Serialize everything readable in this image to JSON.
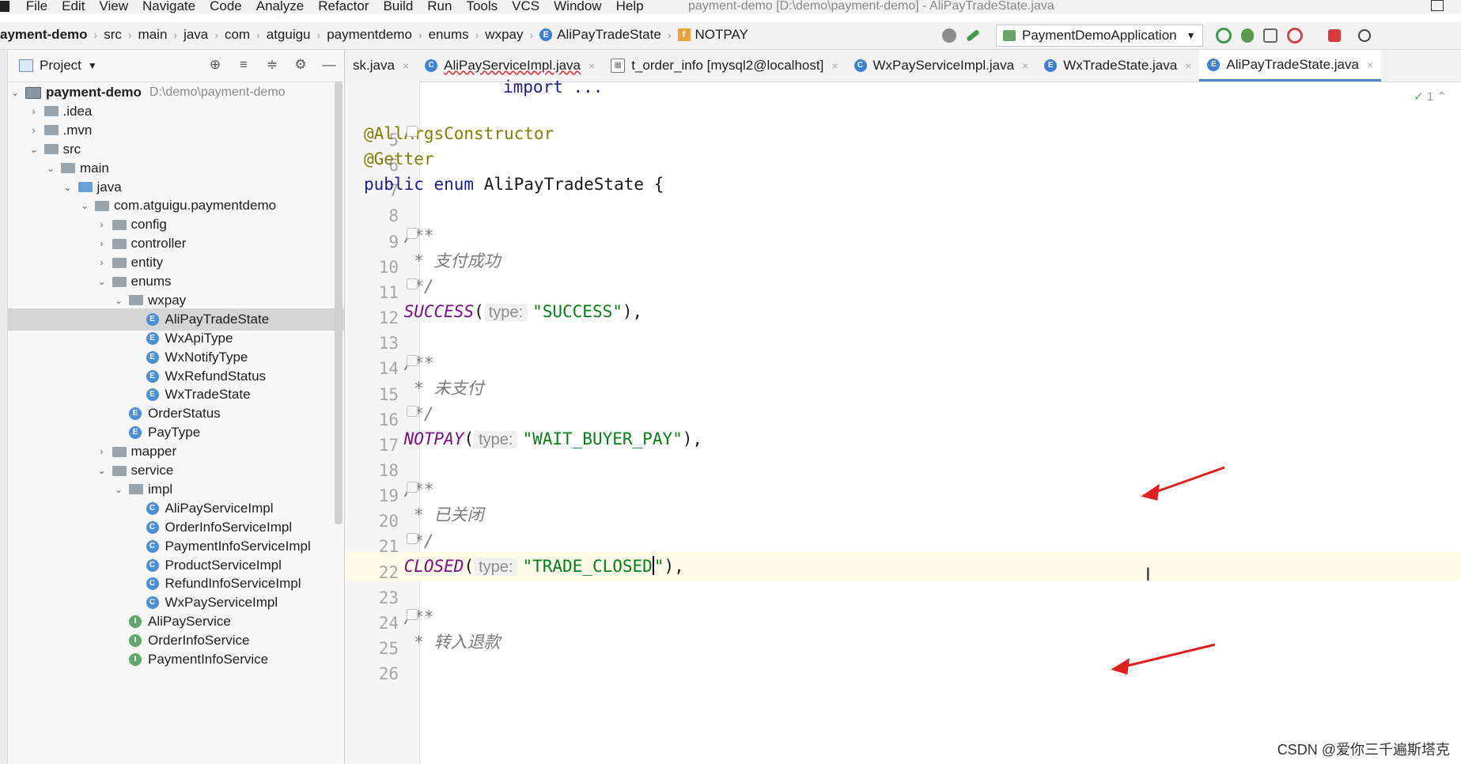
{
  "menu": {
    "items": [
      "File",
      "Edit",
      "View",
      "Navigate",
      "Code",
      "Analyze",
      "Refactor",
      "Build",
      "Run",
      "Tools",
      "VCS",
      "Window",
      "Help"
    ],
    "window_title": "payment-demo [D:\\demo\\payment-demo] - AliPayTradeState.java"
  },
  "breadcrumbs": [
    "ayment-demo",
    "src",
    "main",
    "java",
    "com",
    "atguigu",
    "paymentdemo",
    "enums",
    "wxpay",
    "AliPayTradeState",
    "NOTPAY"
  ],
  "toolbar": {
    "run_config": "PaymentDemoApplication"
  },
  "project_panel": {
    "title": "Project",
    "root": {
      "name": "payment-demo",
      "path": "D:\\demo\\payment-demo"
    },
    "rows": [
      {
        "label": ".idea",
        "indent": 1,
        "arrow": "›",
        "icon": "folder"
      },
      {
        "label": ".mvn",
        "indent": 1,
        "arrow": "›",
        "icon": "folder"
      },
      {
        "label": "src",
        "indent": 1,
        "arrow": "⌄",
        "icon": "folder"
      },
      {
        "label": "main",
        "indent": 2,
        "arrow": "⌄",
        "icon": "folder"
      },
      {
        "label": "java",
        "indent": 3,
        "arrow": "⌄",
        "icon": "folder-blue"
      },
      {
        "label": "com.atguigu.paymentdemo",
        "indent": 4,
        "arrow": "⌄",
        "icon": "folder"
      },
      {
        "label": "config",
        "indent": 5,
        "arrow": "›",
        "icon": "folder"
      },
      {
        "label": "controller",
        "indent": 5,
        "arrow": "›",
        "icon": "folder"
      },
      {
        "label": "entity",
        "indent": 5,
        "arrow": "›",
        "icon": "folder"
      },
      {
        "label": "enums",
        "indent": 5,
        "arrow": "⌄",
        "icon": "folder"
      },
      {
        "label": "wxpay",
        "indent": 6,
        "arrow": "⌄",
        "icon": "folder"
      },
      {
        "label": "AliPayTradeState",
        "indent": 7,
        "arrow": "",
        "icon": "E",
        "selected": true
      },
      {
        "label": "WxApiType",
        "indent": 7,
        "arrow": "",
        "icon": "E"
      },
      {
        "label": "WxNotifyType",
        "indent": 7,
        "arrow": "",
        "icon": "E"
      },
      {
        "label": "WxRefundStatus",
        "indent": 7,
        "arrow": "",
        "icon": "E"
      },
      {
        "label": "WxTradeState",
        "indent": 7,
        "arrow": "",
        "icon": "E"
      },
      {
        "label": "OrderStatus",
        "indent": 6,
        "arrow": "",
        "icon": "E"
      },
      {
        "label": "PayType",
        "indent": 6,
        "arrow": "",
        "icon": "E"
      },
      {
        "label": "mapper",
        "indent": 5,
        "arrow": "›",
        "icon": "folder"
      },
      {
        "label": "service",
        "indent": 5,
        "arrow": "⌄",
        "icon": "folder"
      },
      {
        "label": "impl",
        "indent": 6,
        "arrow": "⌄",
        "icon": "folder"
      },
      {
        "label": "AliPayServiceImpl",
        "indent": 7,
        "arrow": "",
        "icon": "C"
      },
      {
        "label": "OrderInfoServiceImpl",
        "indent": 7,
        "arrow": "",
        "icon": "C"
      },
      {
        "label": "PaymentInfoServiceImpl",
        "indent": 7,
        "arrow": "",
        "icon": "C"
      },
      {
        "label": "ProductServiceImpl",
        "indent": 7,
        "arrow": "",
        "icon": "C"
      },
      {
        "label": "RefundInfoServiceImpl",
        "indent": 7,
        "arrow": "",
        "icon": "C"
      },
      {
        "label": "WxPayServiceImpl",
        "indent": 7,
        "arrow": "",
        "icon": "C"
      },
      {
        "label": "AliPayService",
        "indent": 6,
        "arrow": "",
        "icon": "I"
      },
      {
        "label": "OrderInfoService",
        "indent": 6,
        "arrow": "",
        "icon": "I"
      },
      {
        "label": "PaymentInfoService",
        "indent": 6,
        "arrow": "",
        "icon": "I"
      }
    ]
  },
  "tabs": [
    {
      "label": "sk.java",
      "icon": "",
      "active": false
    },
    {
      "label": "AliPayServiceImpl.java",
      "icon": "C",
      "active": false
    },
    {
      "label": "t_order_info [mysql2@localhost]",
      "icon": "grid",
      "active": false
    },
    {
      "label": "WxPayServiceImpl.java",
      "icon": "C",
      "active": false
    },
    {
      "label": "WxTradeState.java",
      "icon": "E",
      "active": false
    },
    {
      "label": "AliPayTradeState.java",
      "icon": "E",
      "active": true
    }
  ],
  "editor": {
    "inspection_count": "1",
    "lines": [
      {
        "n": "5",
        "parts": []
      },
      {
        "n": "6",
        "parts": [
          {
            "t": "@AllArgsConstructor",
            "c": "ann"
          }
        ]
      },
      {
        "n": "7",
        "parts": [
          {
            "t": "@Getter",
            "c": "ann"
          }
        ]
      },
      {
        "n": "8",
        "parts": [
          {
            "t": "public enum ",
            "c": "kw"
          },
          {
            "t": "AliPayTradeState {",
            "c": ""
          }
        ]
      },
      {
        "n": "9",
        "parts": []
      },
      {
        "n": "10",
        "parts": [
          {
            "t": "    /**",
            "c": "cm"
          }
        ]
      },
      {
        "n": "11",
        "parts": [
          {
            "t": "     * 支付成功",
            "c": "cm"
          }
        ]
      },
      {
        "n": "12",
        "parts": [
          {
            "t": "     */",
            "c": "cm"
          }
        ]
      },
      {
        "n": "13",
        "parts": [
          {
            "t": "    SUCCESS",
            "c": "fld"
          },
          {
            "t": "(",
            "c": ""
          },
          {
            "t": "type:",
            "c": "hint"
          },
          {
            "t": "\"SUCCESS\"",
            "c": "str"
          },
          {
            "t": "),",
            "c": ""
          }
        ]
      },
      {
        "n": "14",
        "parts": []
      },
      {
        "n": "15",
        "parts": [
          {
            "t": "    /**",
            "c": "cm"
          }
        ]
      },
      {
        "n": "16",
        "parts": [
          {
            "t": "     * 未支付",
            "c": "cm"
          }
        ]
      },
      {
        "n": "17",
        "parts": [
          {
            "t": "     */",
            "c": "cm"
          }
        ]
      },
      {
        "n": "18",
        "parts": [
          {
            "t": "    NOTPAY",
            "c": "fld"
          },
          {
            "t": "(",
            "c": ""
          },
          {
            "t": "type:",
            "c": "hint"
          },
          {
            "t": "\"WAIT_BUYER_PAY\"",
            "c": "str"
          },
          {
            "t": "),",
            "c": ""
          }
        ]
      },
      {
        "n": "19",
        "parts": []
      },
      {
        "n": "20",
        "parts": [
          {
            "t": "    /**",
            "c": "cm"
          }
        ]
      },
      {
        "n": "21",
        "parts": [
          {
            "t": "     * 已关闭",
            "c": "cm"
          }
        ]
      },
      {
        "n": "22",
        "parts": [
          {
            "t": "     */",
            "c": "cm"
          }
        ]
      },
      {
        "n": "23",
        "parts": [
          {
            "t": "    CLOSED",
            "c": "fld"
          },
          {
            "t": "(",
            "c": ""
          },
          {
            "t": "type:",
            "c": "hint"
          },
          {
            "t": "\"TRADE_CLOSED",
            "c": "str"
          },
          {
            "t": "|",
            "c": "caret"
          },
          {
            "t": "\"",
            "c": "str"
          },
          {
            "t": "),",
            "c": ""
          }
        ]
      },
      {
        "n": "24",
        "parts": []
      },
      {
        "n": "25",
        "parts": [
          {
            "t": "    /**",
            "c": "cm"
          }
        ]
      },
      {
        "n": "26",
        "parts": [
          {
            "t": "     * 转入退款",
            "c": "cm"
          }
        ]
      }
    ],
    "import_line": "import ..."
  },
  "watermark": "CSDN @爱你三千遍斯塔克",
  "colors": {
    "accent": "#4a88c7",
    "annotation": "#808000",
    "keyword": "#1b1b8f",
    "field": "#7a0f86",
    "string": "#067d17",
    "arrow": "#e02020"
  }
}
